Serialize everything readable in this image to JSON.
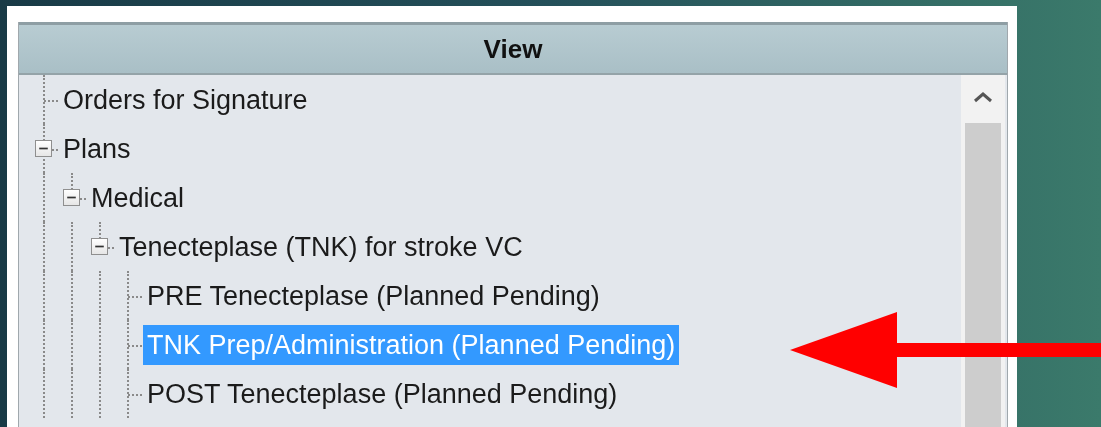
{
  "panel": {
    "header": "View"
  },
  "tree": [
    {
      "label": "Orders for Signature",
      "selected": false
    },
    {
      "label": "Plans",
      "selected": false,
      "expanded": true,
      "children": [
        {
          "label": "Medical",
          "selected": false,
          "expanded": true,
          "children": [
            {
              "label": "Tenecteplase (TNK) for stroke VC",
              "selected": false,
              "expanded": true,
              "children": [
                {
                  "label": "PRE Tenecteplase (Planned Pending)",
                  "selected": false
                },
                {
                  "label": "TNK Prep/Administration (Planned Pending)",
                  "selected": true
                },
                {
                  "label": "POST Tenecteplase (Planned Pending)",
                  "selected": false
                }
              ]
            }
          ]
        }
      ]
    }
  ]
}
